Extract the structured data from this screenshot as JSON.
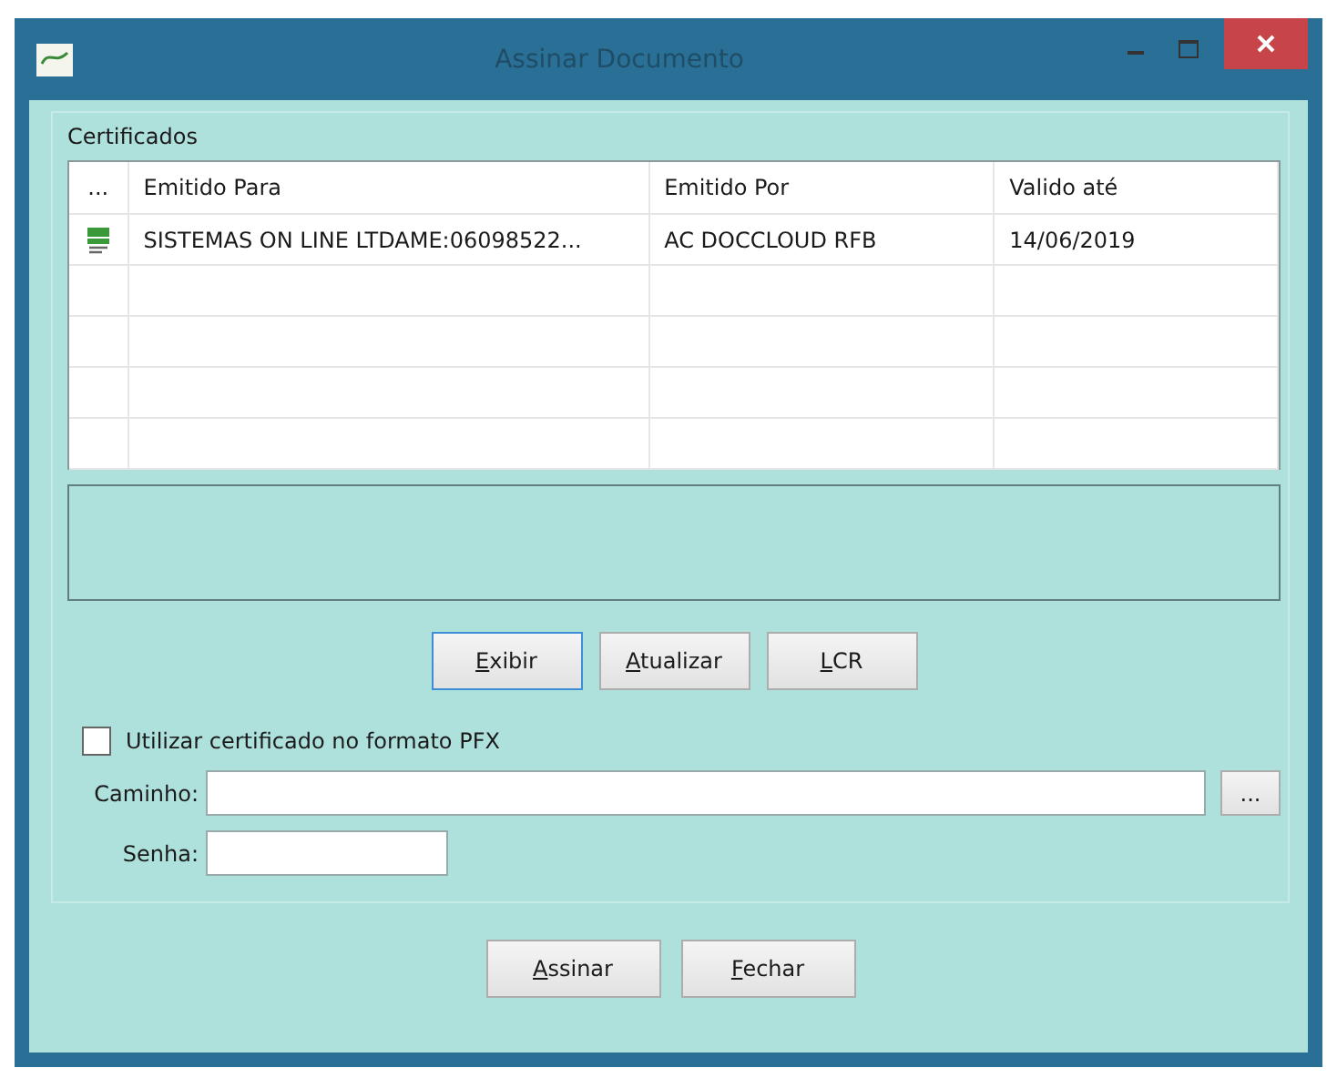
{
  "window": {
    "title": "Assinar Documento"
  },
  "certificates": {
    "title": "Certificados",
    "table": {
      "columns": [
        "...",
        "Emitido Para",
        "Emitido Por",
        "Valido até"
      ],
      "rows": [
        {
          "cells": [
            "",
            "SISTEMAS ON LINE LTDAME:06098522...",
            "AC DOCCLOUD RFB",
            "14/06/2019"
          ],
          "selected": false
        }
      ]
    },
    "buttons": [
      {
        "label": "Exibir",
        "mnemonic": true,
        "focused": true
      },
      {
        "label": "Atualizar",
        "mnemonic": true,
        "focused": false
      },
      {
        "label": "LCR",
        "mnemonic": true,
        "focused": false
      }
    ],
    "pfx_checkbox": {
      "label": "Utilizar certificado no formato PFX",
      "checked": false
    },
    "path": {
      "label": "Caminho:",
      "browse": "..."
    },
    "password": {
      "label": "Senha:"
    }
  },
  "buttons": [
    {
      "label": "Assinar",
      "mnemonic": true
    },
    {
      "label": "Fechar",
      "mnemonic": true
    }
  ]
}
